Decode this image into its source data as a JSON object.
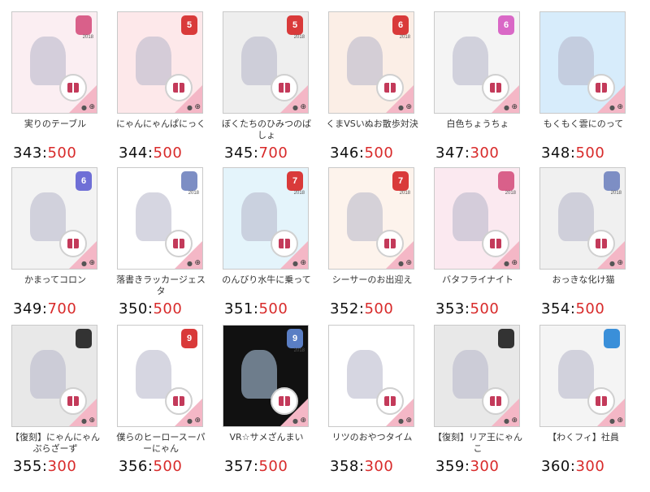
{
  "items": [
    {
      "title": "実りのテーブル",
      "num": "343",
      "cost": "500",
      "badge": "",
      "year": "2018",
      "badge_color": "#d9608a",
      "bg": "#fbeef2"
    },
    {
      "title": "にゃんにゃんぱにっく",
      "num": "344",
      "cost": "500",
      "badge": "5",
      "year": "",
      "badge_color": "#d93a3a",
      "bg": "#fde8ea"
    },
    {
      "title": "ぼくたちのひみつのばしょ",
      "num": "345",
      "cost": "700",
      "badge": "5",
      "year": "2018",
      "badge_color": "#d93a3a",
      "bg": "#eeeeee"
    },
    {
      "title": "くまVSいぬお散歩対決",
      "num": "346",
      "cost": "500",
      "badge": "6",
      "year": "2018",
      "badge_color": "#d93a3a",
      "bg": "#fbeee6"
    },
    {
      "title": "白色ちょうちょ",
      "num": "347",
      "cost": "300",
      "badge": "6",
      "year": "",
      "badge_color": "#d968c6",
      "bg": "#f4f4f4"
    },
    {
      "title": "もくもく雲にのって",
      "num": "348",
      "cost": "500",
      "badge": "",
      "year": "",
      "badge_color": "#ffffff",
      "bg": "#d7ecfb"
    },
    {
      "title": "かまってコロン",
      "num": "349",
      "cost": "700",
      "badge": "6",
      "year": "",
      "badge_color": "#6f6fd6",
      "bg": "#f3f3f3"
    },
    {
      "title": "落書きラッカージェスタ",
      "num": "350",
      "cost": "500",
      "badge": "",
      "year": "2018",
      "badge_color": "#7d8ec4",
      "bg": "#ffffff"
    },
    {
      "title": "のんびり水牛に乗って",
      "num": "351",
      "cost": "500",
      "badge": "7",
      "year": "2018",
      "badge_color": "#d93a3a",
      "bg": "#e4f4fb"
    },
    {
      "title": "シーサーのお出迎え",
      "num": "352",
      "cost": "500",
      "badge": "7",
      "year": "2018",
      "badge_color": "#d93a3a",
      "bg": "#fdf3ec"
    },
    {
      "title": "バタフライナイト",
      "num": "353",
      "cost": "500",
      "badge": "",
      "year": "2018",
      "badge_color": "#d9608a",
      "bg": "#fbe9f0"
    },
    {
      "title": "おっきな化け猫",
      "num": "354",
      "cost": "500",
      "badge": "",
      "year": "2018",
      "badge_color": "#7d8ec4",
      "bg": "#f0f0f0"
    },
    {
      "title": "【復刻】にゃんにゃんぷらざーず",
      "num": "355",
      "cost": "300",
      "badge": "",
      "year": "",
      "badge_color": "#333333",
      "bg": "#e8e8e8"
    },
    {
      "title": "僕らのヒーロースーパーにゃん",
      "num": "356",
      "cost": "500",
      "badge": "9",
      "year": "",
      "badge_color": "#d93a3a",
      "bg": "#ffffff"
    },
    {
      "title": "VR☆サメざんまい",
      "num": "357",
      "cost": "500",
      "badge": "9",
      "year": "2018",
      "badge_color": "#5a7ec4",
      "bg": "#111111"
    },
    {
      "title": "リツのおやつタイム",
      "num": "358",
      "cost": "300",
      "badge": "",
      "year": "",
      "badge_color": "#ffffff",
      "bg": "#ffffff"
    },
    {
      "title": "【復刻】リア王にゃんこ",
      "num": "359",
      "cost": "300",
      "badge": "",
      "year": "",
      "badge_color": "#333333",
      "bg": "#e8e8e8"
    },
    {
      "title": "【わくフィ】社員",
      "num": "360",
      "cost": "300",
      "badge": "",
      "year": "",
      "badge_color": "#3a8fd9",
      "bg": "#f4f4f4"
    }
  ],
  "separator": ":",
  "icons": {
    "zoom": "zoom-plus-icon",
    "person": "person-icon",
    "gift": "gift-icon"
  }
}
